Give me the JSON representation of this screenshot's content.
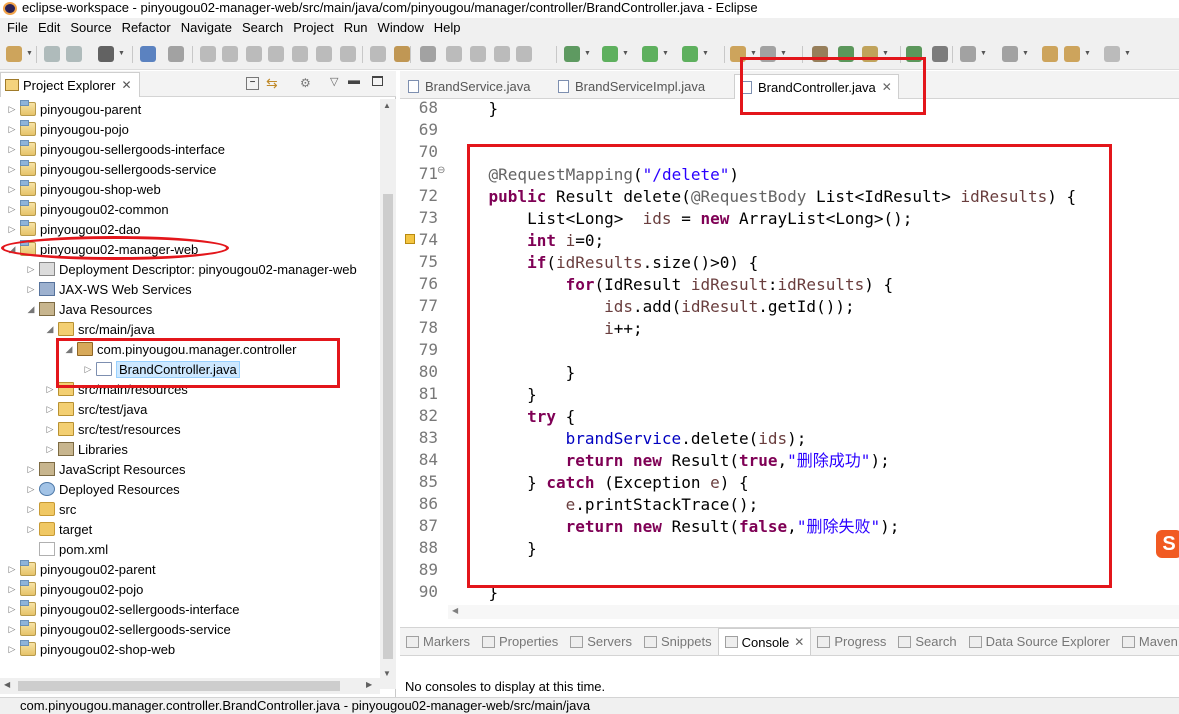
{
  "window": {
    "title": "eclipse-workspace - pinyougou02-manager-web/src/main/java/com/pinyougou/manager/controller/BrandController.java - Eclipse"
  },
  "menu": [
    "File",
    "Edit",
    "Source",
    "Refactor",
    "Navigate",
    "Search",
    "Project",
    "Run",
    "Window",
    "Help"
  ],
  "project_explorer": {
    "title": "Project Explorer",
    "tree": [
      {
        "label": "pinyougou-parent",
        "icon": "project-icon",
        "depth": 0,
        "expand": "collapsed"
      },
      {
        "label": "pinyougou-pojo",
        "icon": "project-icon",
        "depth": 0,
        "expand": "collapsed"
      },
      {
        "label": "pinyougou-sellergoods-interface",
        "icon": "project-icon",
        "depth": 0,
        "expand": "collapsed"
      },
      {
        "label": "pinyougou-sellergoods-service",
        "icon": "project-icon",
        "depth": 0,
        "expand": "collapsed"
      },
      {
        "label": "pinyougou-shop-web",
        "icon": "project-icon",
        "depth": 0,
        "expand": "collapsed"
      },
      {
        "label": "pinyougou02-common",
        "icon": "project-icon",
        "depth": 0,
        "expand": "collapsed"
      },
      {
        "label": "pinyougou02-dao",
        "icon": "project-icon",
        "depth": 0,
        "expand": "collapsed"
      },
      {
        "label": "pinyougou02-manager-web",
        "icon": "project-icon",
        "depth": 0,
        "expand": "expanded"
      },
      {
        "label": "Deployment Descriptor: pinyougou02-manager-web",
        "icon": "deployment-descriptor-icon",
        "depth": 1,
        "expand": "collapsed"
      },
      {
        "label": "JAX-WS Web Services",
        "icon": "web-services-icon",
        "depth": 1,
        "expand": "collapsed"
      },
      {
        "label": "Java Resources",
        "icon": "java-resources-icon",
        "depth": 1,
        "expand": "expanded"
      },
      {
        "label": "src/main/java",
        "icon": "source-folder-icon",
        "depth": 2,
        "expand": "expanded"
      },
      {
        "label": "com.pinyougou.manager.controller",
        "icon": "package-icon",
        "depth": 3,
        "expand": "expanded"
      },
      {
        "label": "BrandController.java",
        "icon": "java-file-icon",
        "depth": 4,
        "expand": "collapsed",
        "selected": true
      },
      {
        "label": "src/main/resources",
        "icon": "source-folder-icon",
        "depth": 2,
        "expand": "collapsed"
      },
      {
        "label": "src/test/java",
        "icon": "source-folder-icon",
        "depth": 2,
        "expand": "collapsed"
      },
      {
        "label": "src/test/resources",
        "icon": "source-folder-icon",
        "depth": 2,
        "expand": "collapsed"
      },
      {
        "label": "Libraries",
        "icon": "libraries-icon",
        "depth": 2,
        "expand": "collapsed"
      },
      {
        "label": "JavaScript Resources",
        "icon": "javascript-resources-icon",
        "depth": 1,
        "expand": "collapsed"
      },
      {
        "label": "Deployed Resources",
        "icon": "deployed-resources-icon",
        "depth": 1,
        "expand": "collapsed"
      },
      {
        "label": "src",
        "icon": "folder-icon",
        "depth": 1,
        "expand": "collapsed"
      },
      {
        "label": "target",
        "icon": "folder-icon",
        "depth": 1,
        "expand": "collapsed"
      },
      {
        "label": "pom.xml",
        "icon": "xml-file-icon",
        "depth": 1,
        "expand": "none"
      },
      {
        "label": "pinyougou02-parent",
        "icon": "project-icon",
        "depth": 0,
        "expand": "collapsed"
      },
      {
        "label": "pinyougou02-pojo",
        "icon": "project-icon",
        "depth": 0,
        "expand": "collapsed"
      },
      {
        "label": "pinyougou02-sellergoods-interface",
        "icon": "project-icon",
        "depth": 0,
        "expand": "collapsed"
      },
      {
        "label": "pinyougou02-sellergoods-service",
        "icon": "project-icon",
        "depth": 0,
        "expand": "collapsed"
      },
      {
        "label": "pinyougou02-shop-web",
        "icon": "project-icon",
        "depth": 0,
        "expand": "collapsed"
      }
    ]
  },
  "editor": {
    "tabs": [
      {
        "label": "BrandService.java"
      },
      {
        "label": "BrandServiceImpl.java"
      },
      {
        "label": "BrandController.java",
        "active": true
      }
    ],
    "lines": [
      {
        "n": "68",
        "tokens": [
          [
            "p",
            "    }"
          ]
        ]
      },
      {
        "n": "69",
        "tokens": []
      },
      {
        "n": "70",
        "tokens": []
      },
      {
        "n": "71",
        "tokens": [
          [
            "p",
            "    "
          ],
          [
            "ann",
            "@RequestMapping"
          ],
          [
            "p",
            "("
          ],
          [
            "str",
            "\"/delete\""
          ],
          [
            "p",
            ")"
          ]
        ]
      },
      {
        "n": "72",
        "tokens": [
          [
            "p",
            "    "
          ],
          [
            "kw",
            "public"
          ],
          [
            "p",
            " Result delete("
          ],
          [
            "ann",
            "@RequestBody"
          ],
          [
            "p",
            " List<IdResult> "
          ],
          [
            "prm",
            "idResults"
          ],
          [
            "p",
            ") {"
          ]
        ]
      },
      {
        "n": "73",
        "tokens": [
          [
            "p",
            "        List<Long>  "
          ],
          [
            "prm",
            "ids"
          ],
          [
            "p",
            " = "
          ],
          [
            "kw",
            "new"
          ],
          [
            "p",
            " ArrayList<Long>();"
          ]
        ]
      },
      {
        "n": "74",
        "tokens": [
          [
            "p",
            "        "
          ],
          [
            "kw",
            "int"
          ],
          [
            "p",
            " "
          ],
          [
            "prm",
            "i"
          ],
          [
            "p",
            "=0;"
          ]
        ]
      },
      {
        "n": "75",
        "tokens": [
          [
            "p",
            "        "
          ],
          [
            "kw",
            "if"
          ],
          [
            "p",
            "("
          ],
          [
            "prm",
            "idResults"
          ],
          [
            "p",
            ".size()>0) {"
          ]
        ]
      },
      {
        "n": "76",
        "tokens": [
          [
            "p",
            "            "
          ],
          [
            "kw",
            "for"
          ],
          [
            "p",
            "(IdResult "
          ],
          [
            "prm",
            "idResult"
          ],
          [
            "p",
            ":"
          ],
          [
            "prm",
            "idResults"
          ],
          [
            "p",
            ") {"
          ]
        ]
      },
      {
        "n": "77",
        "tokens": [
          [
            "p",
            "                "
          ],
          [
            "prm",
            "ids"
          ],
          [
            "p",
            ".add("
          ],
          [
            "prm",
            "idResult"
          ],
          [
            "p",
            ".getId());"
          ]
        ]
      },
      {
        "n": "78",
        "tokens": [
          [
            "p",
            "                "
          ],
          [
            "prm",
            "i"
          ],
          [
            "p",
            "++;"
          ]
        ]
      },
      {
        "n": "79",
        "tokens": []
      },
      {
        "n": "80",
        "tokens": [
          [
            "p",
            "            }"
          ]
        ]
      },
      {
        "n": "81",
        "tokens": [
          [
            "p",
            "        }"
          ]
        ]
      },
      {
        "n": "82",
        "tokens": [
          [
            "p",
            "        "
          ],
          [
            "kw",
            "try"
          ],
          [
            "p",
            " {"
          ]
        ]
      },
      {
        "n": "83",
        "tokens": [
          [
            "p",
            "            "
          ],
          [
            "fld",
            "brandService"
          ],
          [
            "p",
            ".delete("
          ],
          [
            "prm",
            "ids"
          ],
          [
            "p",
            ");"
          ]
        ]
      },
      {
        "n": "84",
        "tokens": [
          [
            "p",
            "            "
          ],
          [
            "kw",
            "return"
          ],
          [
            "p",
            " "
          ],
          [
            "kw",
            "new"
          ],
          [
            "p",
            " Result("
          ],
          [
            "kw",
            "true"
          ],
          [
            "p",
            ","
          ],
          [
            "str",
            "\"删除成功\""
          ],
          [
            "p",
            ");"
          ]
        ]
      },
      {
        "n": "85",
        "tokens": [
          [
            "p",
            "        } "
          ],
          [
            "kw",
            "catch"
          ],
          [
            "p",
            " (Exception "
          ],
          [
            "prm",
            "e"
          ],
          [
            "p",
            ") {"
          ]
        ]
      },
      {
        "n": "86",
        "tokens": [
          [
            "p",
            "            "
          ],
          [
            "prm",
            "e"
          ],
          [
            "p",
            ".printStackTrace();"
          ]
        ]
      },
      {
        "n": "87",
        "tokens": [
          [
            "p",
            "            "
          ],
          [
            "kw",
            "return"
          ],
          [
            "p",
            " "
          ],
          [
            "kw",
            "new"
          ],
          [
            "p",
            " Result("
          ],
          [
            "kw",
            "false"
          ],
          [
            "p",
            ","
          ],
          [
            "str",
            "\"删除失败\""
          ],
          [
            "p",
            ");"
          ]
        ]
      },
      {
        "n": "88",
        "tokens": [
          [
            "p",
            "        }"
          ]
        ]
      },
      {
        "n": "89",
        "tokens": []
      },
      {
        "n": "90",
        "tokens": [
          [
            "p",
            "    }"
          ]
        ]
      }
    ]
  },
  "bottom_panel": {
    "tabs": [
      {
        "label": "Markers",
        "icon": "markers-icon"
      },
      {
        "label": "Properties",
        "icon": "properties-icon"
      },
      {
        "label": "Servers",
        "icon": "servers-icon"
      },
      {
        "label": "Snippets",
        "icon": "snippets-icon"
      },
      {
        "label": "Console",
        "icon": "console-icon",
        "active": true
      },
      {
        "label": "Progress",
        "icon": "progress-icon"
      },
      {
        "label": "Search",
        "icon": "search-icon"
      },
      {
        "label": "Data Source Explorer",
        "icon": "data-source-icon"
      },
      {
        "label": "Maven",
        "icon": "maven-icon"
      }
    ],
    "message": "No consoles to display at this time."
  },
  "status": {
    "text": "com.pinyougou.manager.controller.BrandController.java - pinyougou02-manager-web/src/main/java"
  },
  "colors": {
    "annotation_red": "#e3161b",
    "keyword": "#7f0055",
    "string": "#2a00ff",
    "current_line": "#e8f2fe"
  },
  "watermark": {
    "label": "S"
  }
}
